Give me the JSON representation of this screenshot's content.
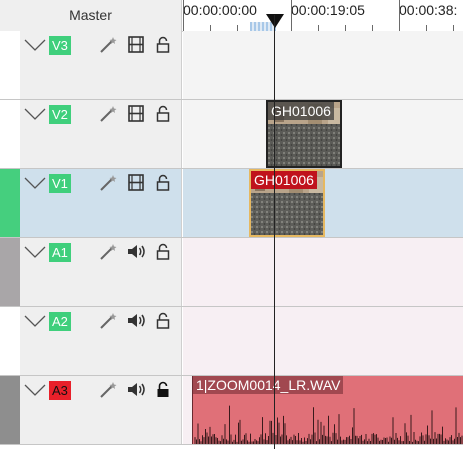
{
  "ruler": {
    "master_label": "Master",
    "timecodes": [
      "00:00:00:00",
      "00:00:19:05",
      "00:00:38:"
    ]
  },
  "tracks": [
    {
      "name": "V3",
      "type": "video",
      "color": "#3fcf7c",
      "locked": false,
      "selected": false
    },
    {
      "name": "V2",
      "type": "video",
      "color": "#3fcf7c",
      "locked": false,
      "selected": false
    },
    {
      "name": "V1",
      "type": "video",
      "color": "#3fcf7c",
      "locked": false,
      "selected": true
    },
    {
      "name": "A1",
      "type": "audio",
      "color": "#3fcf7c",
      "locked": false,
      "selected": false
    },
    {
      "name": "A2",
      "type": "audio",
      "color": "#3fcf7c",
      "locked": false,
      "selected": false
    },
    {
      "name": "A3",
      "type": "audio",
      "color": "#e8202a",
      "locked": true,
      "selected": false
    }
  ],
  "clips": {
    "v2_clip": {
      "label": "GH01006"
    },
    "v1_clip": {
      "label": "GH01006"
    },
    "a3_clip": {
      "label": "1|ZOOM0014_LR.WAV"
    }
  },
  "colors": {
    "selected_track_bg": "#cfe0ec",
    "audio_lane_bg": "#f7eff3",
    "audio_clip": "#e07078",
    "clip_label_red": "#c0121c"
  },
  "icons": [
    "chevron-down-icon",
    "magic-wand-icon",
    "film-icon",
    "speaker-icon",
    "lock-icon"
  ]
}
